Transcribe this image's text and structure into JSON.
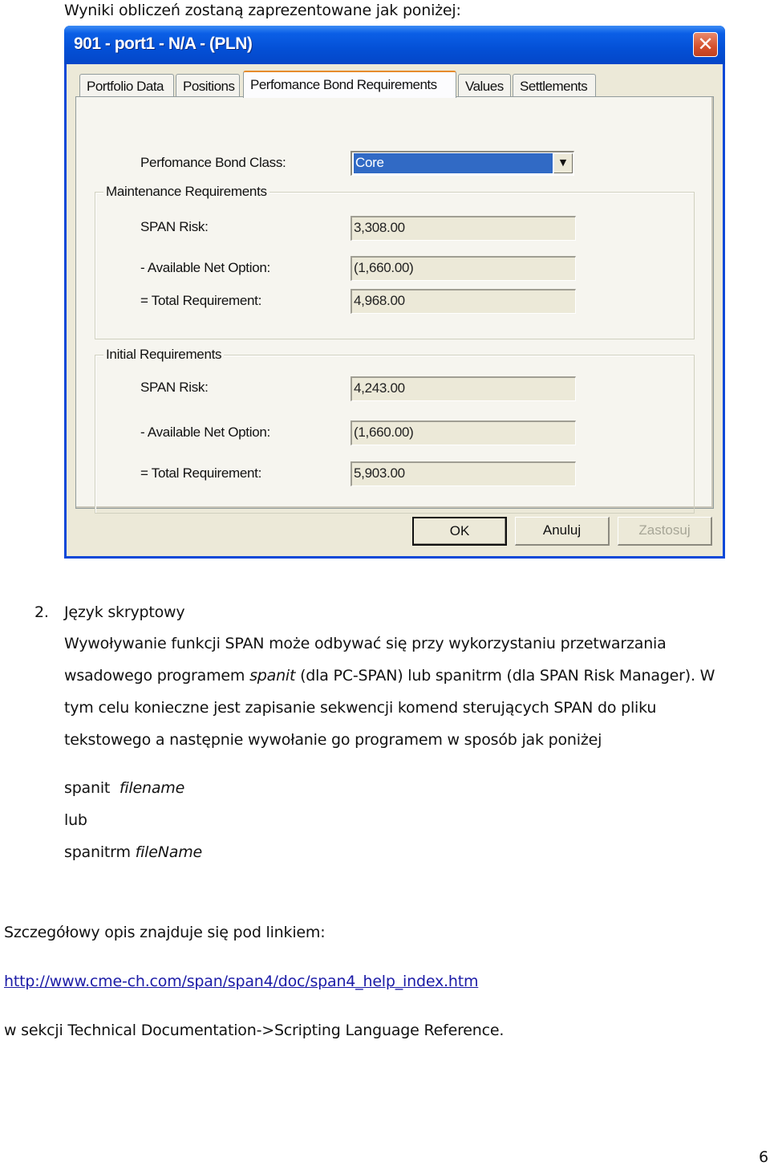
{
  "intro_text": "Wyniki obliczeń zostaną zaprezentowane jak poniżej:",
  "dialog": {
    "title": "901 - port1 - N/A - (PLN)",
    "close_icon": "close-x-icon",
    "tabs": [
      {
        "label": "Portfolio Data",
        "active": false
      },
      {
        "label": "Positions",
        "active": false
      },
      {
        "label": "Perfomance Bond Requirements",
        "active": true
      },
      {
        "label": "Values",
        "active": false
      },
      {
        "label": "Settlements",
        "active": false
      }
    ],
    "bond_class": {
      "label": "Perfomance Bond Class:",
      "value": "Core",
      "dropdown_icon": "triangle-down-icon"
    },
    "maintenance": {
      "title": "Maintenance Requirements",
      "rows": [
        {
          "label": "SPAN Risk:",
          "value": "3,308.00"
        },
        {
          "label": "- Available Net Option:",
          "value": "(1,660.00)"
        },
        {
          "label": "= Total Requirement:",
          "value": "4,968.00"
        }
      ]
    },
    "initial": {
      "title": "Initial Requirements",
      "rows": [
        {
          "label": "SPAN Risk:",
          "value": "4,243.00"
        },
        {
          "label": "- Available Net Option:",
          "value": "(1,660.00)"
        },
        {
          "label": "= Total Requirement:",
          "value": "5,903.00"
        }
      ]
    },
    "buttons": {
      "ok": "OK",
      "cancel": "Anuluj",
      "apply": "Zastosuj"
    }
  },
  "section": {
    "number": "2.",
    "heading": "Język skryptowy",
    "para_lines": {
      "l1": "Wywoływanie funkcji SPAN może odbywać się przy wykorzystaniu przetwarzania",
      "l2_a": "wsadowego programem ",
      "l2_italic": "spanit",
      "l2_b": " (dla PC-SPAN) lub spanitrm (dla SPAN Risk Manager).  W",
      "l3": "tym celu konieczne jest zapisanie sekwencji komend sterujących SPAN do pliku",
      "l4": "tekstowego a następnie wywołanie go programem w sposób jak poniżej"
    },
    "commands": {
      "c1_cmd": "spanit  ",
      "c1_arg": "filename",
      "or": "lub",
      "c2_cmd": "spanitrm ",
      "c2_arg": "fileName"
    }
  },
  "details_text": "Szczegółowy opis znajduje się pod linkiem:",
  "link_url": "http://www.cme-ch.com/span/span4/doc/span4_help_index.htm",
  "section_ref": "w sekcji Technical Documentation->Scripting Language Reference.",
  "page_number": "6"
}
